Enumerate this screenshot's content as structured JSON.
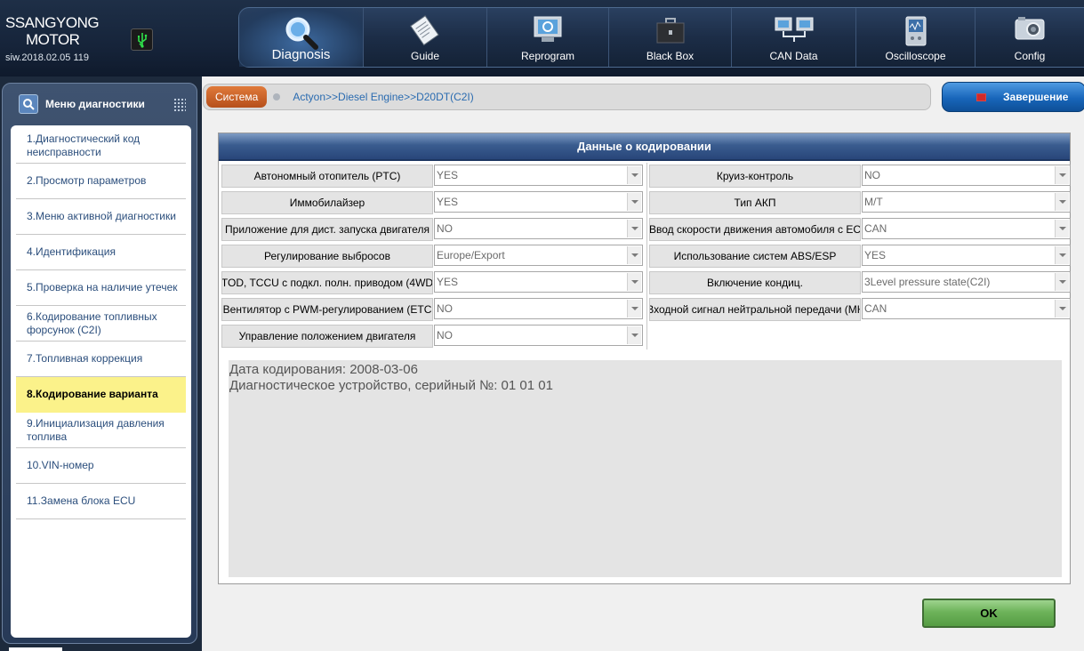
{
  "brand": {
    "line1": "SSANGYONG",
    "line2": "MOTOR",
    "version": "siw.2018.02.05 119"
  },
  "nav": [
    {
      "label": "Diagnosis",
      "icon": "magnifier-icon",
      "active": true
    },
    {
      "label": "Guide",
      "icon": "guide-book-icon"
    },
    {
      "label": "Reprogram",
      "icon": "reprogram-monitor-icon"
    },
    {
      "label": "Black Box",
      "icon": "black-box-case-icon"
    },
    {
      "label": "CAN Data",
      "icon": "can-network-icon"
    },
    {
      "label": "Oscilloscope",
      "icon": "oscilloscope-icon"
    },
    {
      "label": "Config",
      "icon": "config-camera-icon"
    }
  ],
  "sidebar": {
    "title": "Меню диагностики",
    "items": [
      {
        "label": "1.Диагностический код неисправности"
      },
      {
        "label": "2.Просмотр параметров"
      },
      {
        "label": "3.Меню активной диагностики"
      },
      {
        "label": "4.Идентификация"
      },
      {
        "label": "5.Проверка на наличие утечек"
      },
      {
        "label": "6.Кодирование топливных форсунок (C2I)"
      },
      {
        "label": "7.Топливная коррекция"
      },
      {
        "label": "8.Кодирование варианта",
        "active": true
      },
      {
        "label": "9.Инициализация давления топлива"
      },
      {
        "label": "10.VIN-номер"
      },
      {
        "label": "11.Замена блока ECU"
      }
    ]
  },
  "breadcrumb": {
    "button": "Система",
    "path": "Actyon>>Diesel Engine>>D20DT(C2I)"
  },
  "exit_label": "Завершение",
  "panel": {
    "title": "Данные о кодировании",
    "left": [
      {
        "label": "Автономный отопитель (PTC)",
        "value": "YES"
      },
      {
        "label": "Иммобилайзер",
        "value": "YES"
      },
      {
        "label": "Приложение для дист. запуска двигателя",
        "value": "NO"
      },
      {
        "label": "Регулирование выбросов",
        "value": "Europe/Export"
      },
      {
        "label": "TOD, TCCU с подкл. полн. приводом (4WD",
        "value": "YES"
      },
      {
        "label": "Вентилятор с PWM-регулированием (ETC",
        "value": "NO"
      },
      {
        "label": "Управление положением двигателя",
        "value": "NO"
      }
    ],
    "right": [
      {
        "label": "Круиз-контроль",
        "value": "NO"
      },
      {
        "label": "Тип АКП",
        "value": "M/T"
      },
      {
        "label": "Ввод скорости движения автомобиля с EC",
        "value": "CAN"
      },
      {
        "label": "Использование систем ABS/ESP",
        "value": "YES"
      },
      {
        "label": "Включение кондиц.",
        "value": "3Level pressure state(C2I)"
      },
      {
        "label": "Входной сигнал нейтральной передачи (МК",
        "value": "CAN"
      }
    ],
    "info": {
      "line1": "Дата кодирования: 2008-03-06",
      "line2": "Диагностическое устройство, серийный №: 01 01 01"
    }
  },
  "ok_label": "OK"
}
